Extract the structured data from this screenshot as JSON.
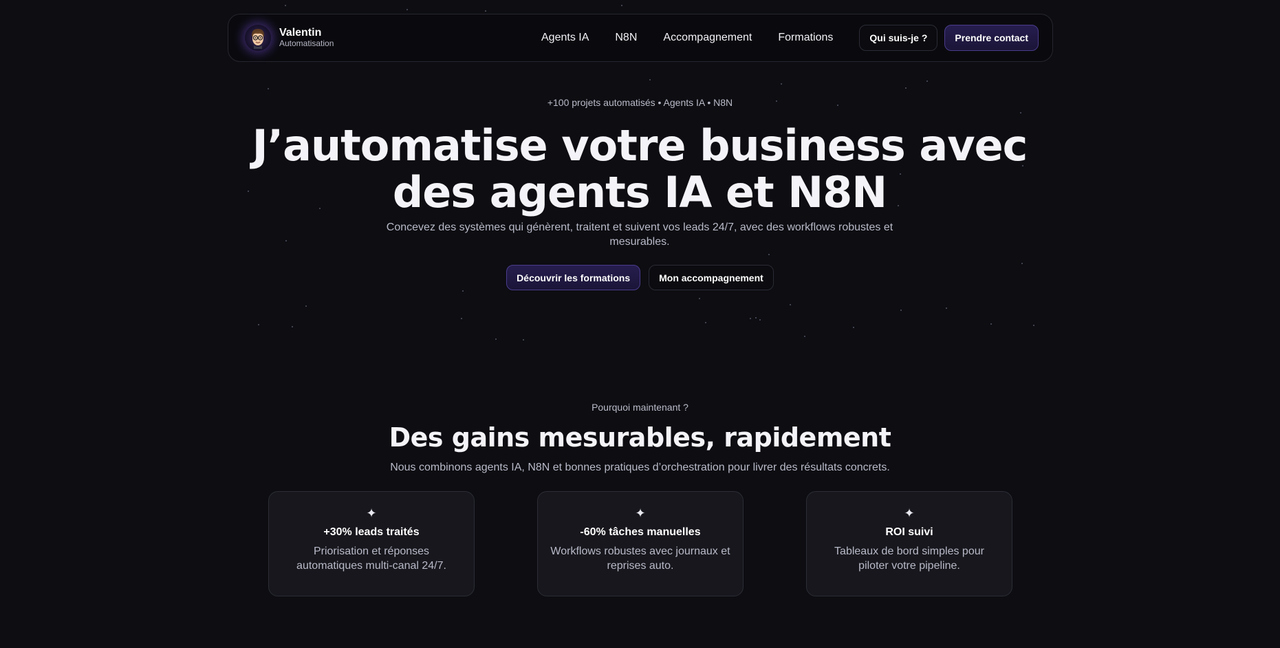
{
  "brand": {
    "name": "Valentin",
    "subtitle": "Automatisation"
  },
  "nav": {
    "links": [
      "Agents IA",
      "N8N",
      "Accompagnement",
      "Formations"
    ],
    "about_label": "Qui suis-je ?",
    "contact_label": "Prendre contact"
  },
  "hero": {
    "tagline": "+100 projets automatisés • Agents IA • N8N",
    "title_line1": "J’automatise votre business avec",
    "title_line2": "des agents IA et N8N",
    "subtitle": "Concevez des systèmes qui génèrent, traitent et suivent vos leads 24/7, avec des workflows robustes et mesurables.",
    "cta_primary": "Découvrir les formations",
    "cta_secondary": "Mon accompagnement"
  },
  "why": {
    "eyebrow": "Pourquoi maintenant ?",
    "title": "Des gains mesurables, rapidement",
    "subtitle": "Nous combinons agents IA, N8N et bonnes pratiques d’orchestration pour livrer des résultats concrets.",
    "cards": [
      {
        "icon": "sparkle-icon",
        "glyph": "✦",
        "title": "+30% leads traités",
        "text": "Priorisation et réponses automatiques multi-canal 24/7."
      },
      {
        "icon": "sparkle-icon",
        "glyph": "✦",
        "title": "-60% tâches manuelles",
        "text": "Workflows robustes avec journaux et reprises auto."
      },
      {
        "icon": "sparkle-icon",
        "glyph": "✦",
        "title": "ROI suivi",
        "text": "Tableaux de bord simples pour piloter votre pipeline."
      }
    ]
  },
  "colors": {
    "background": "#0d0d12",
    "accent": "#261d4e",
    "accent_border": "#4b3c8c",
    "card_bg": "#17171d"
  }
}
